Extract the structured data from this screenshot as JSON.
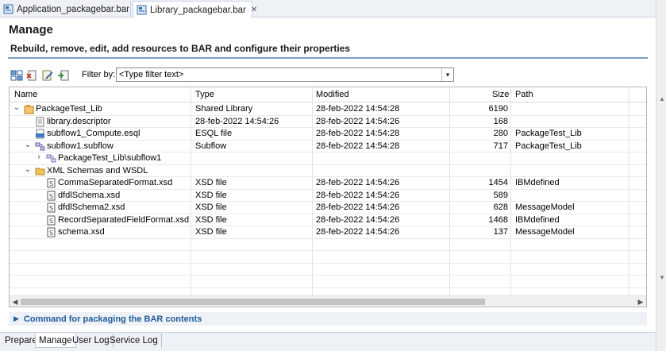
{
  "editor_tabs": [
    {
      "label": "Application_packagebar.bar",
      "active": false
    },
    {
      "label": "Library_packagebar.bar",
      "active": true,
      "close": "✕"
    }
  ],
  "page": {
    "title": "Manage",
    "subtitle": "Rebuild, remove, edit, add resources to BAR and configure their properties"
  },
  "toolbar": {
    "icons": [
      "build-icon",
      "remove-icon",
      "edit-icon",
      "add-icon"
    ],
    "filter_label": "Filter by:",
    "filter_value": "<Type filter text>"
  },
  "table": {
    "columns": [
      "Name",
      "Type",
      "Modified",
      "Size",
      "Path"
    ],
    "rows": [
      {
        "name": "PackageTest_Lib",
        "type": "Shared Library",
        "modified": "28-feb-2022  14:54:28",
        "size": "6190",
        "path": "",
        "icon": "library-icon",
        "twisty": "expanded",
        "level": 0
      },
      {
        "name": "library.descriptor",
        "type": "28-feb-2022  14:54:26",
        "modified": "28-feb-2022  14:54:26",
        "size": "168",
        "path": "",
        "icon": "descriptor-file-icon",
        "twisty": "",
        "level": 1
      },
      {
        "name": "subflow1_Compute.esql",
        "type": "ESQL file",
        "modified": "28-feb-2022  14:54:28",
        "size": "280",
        "path": "PackageTest_Lib",
        "icon": "esql-file-icon",
        "twisty": "",
        "level": 1
      },
      {
        "name": "subflow1.subflow",
        "type": "Subflow",
        "modified": "28-feb-2022  14:54:28",
        "size": "717",
        "path": "PackageTest_Lib",
        "icon": "subflow-icon",
        "twisty": "expanded",
        "level": 1
      },
      {
        "name": "PackageTest_Lib\\subflow1",
        "type": "",
        "modified": "",
        "size": "",
        "path": "",
        "icon": "subflow-node-icon",
        "twisty": "collapsed",
        "level": 2
      },
      {
        "name": "XML Schemas and WSDL",
        "type": "",
        "modified": "",
        "size": "",
        "path": "",
        "icon": "folder-icon",
        "twisty": "expanded",
        "level": 1
      },
      {
        "name": "CommaSeparatedFormat.xsd",
        "type": "XSD file",
        "modified": "28-feb-2022  14:54:26",
        "size": "1454",
        "path": "IBMdefined",
        "icon": "xsd-file-icon",
        "twisty": "",
        "level": 2
      },
      {
        "name": "dfdlSchema.xsd",
        "type": "XSD file",
        "modified": "28-feb-2022  14:54:26",
        "size": "589",
        "path": "",
        "icon": "xsd-file-icon",
        "twisty": "",
        "level": 2
      },
      {
        "name": "dfdlSchema2.xsd",
        "type": "XSD file",
        "modified": "28-feb-2022  14:54:26",
        "size": "628",
        "path": "MessageModel",
        "icon": "xsd-file-icon",
        "twisty": "",
        "level": 2
      },
      {
        "name": "RecordSeparatedFieldFormat.xsd",
        "type": "XSD file",
        "modified": "28-feb-2022  14:54:26",
        "size": "1468",
        "path": "IBMdefined",
        "icon": "xsd-file-icon",
        "twisty": "",
        "level": 2
      },
      {
        "name": "schema.xsd",
        "type": "XSD file",
        "modified": "28-feb-2022  14:54:26",
        "size": "137",
        "path": "MessageModel",
        "icon": "xsd-file-icon",
        "twisty": "",
        "level": 2
      }
    ],
    "empty_rows": 6
  },
  "command_section": {
    "label": "Command for packaging the BAR contents",
    "state": "collapsed"
  },
  "bottom_tabs": [
    {
      "label": "Prepare",
      "active": false
    },
    {
      "label": "Manage",
      "active": true
    },
    {
      "label": "User Log",
      "active": false
    },
    {
      "label": "Service Log",
      "active": false
    }
  ],
  "colors": {
    "accent": "#1e5b9a",
    "header_rule": "#7a9cc6",
    "tab_bg": "#eef1f6"
  }
}
